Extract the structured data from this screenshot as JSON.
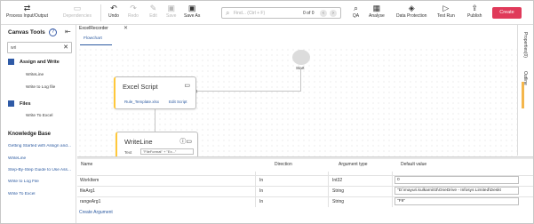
{
  "toolbar": {
    "process_io": "Process Input/Output",
    "dependencies": "Dependencies",
    "undo": "Undo",
    "redo": "Redo",
    "edit": "Edit",
    "save": "Save",
    "save_as": "Save As",
    "search_placeholder": "Find... (Ctrl + F)",
    "search_count": "0 of 0",
    "qa": "QA",
    "analyse": "Analyse",
    "data_protection": "Data Protection",
    "test_run": "Test Run",
    "publish": "Publish",
    "create": "Create"
  },
  "left_panel": {
    "title": "Canvas Tools",
    "filter_value": "wri",
    "tree": [
      {
        "group": "Assign and Write",
        "leaves": [
          "WriteLine",
          "Write to Log file"
        ]
      },
      {
        "group": "Files",
        "leaves": [
          "Write To Excel"
        ]
      }
    ],
    "kb_title": "Knowledge Base",
    "kb_links": [
      "Getting Started with Assign and...",
      "WriteLine",
      "Step-By-Step Guide to Use Ass...",
      "Write to Log File",
      "Write To Excel"
    ]
  },
  "tabs": {
    "main": "ExcelRecorder",
    "sub": "Flowchart"
  },
  "canvas": {
    "excel_node": {
      "title": "Excel Script",
      "link1": "Rule_Template.xlsx",
      "link2": "Edit Script"
    },
    "write_node": {
      "title": "WriteLine",
      "field": "Text",
      "field_value": "\"FileFormat\" + \"Ex...\""
    },
    "start_label": "Start"
  },
  "right_rail": {
    "properties": "Properties(0)",
    "outline": "Outline"
  },
  "arguments": {
    "headers": {
      "name": "Name",
      "direction": "Direction",
      "type": "Argument type",
      "default": "Default value"
    },
    "rows": [
      {
        "name": "WorkItem",
        "direction": "In",
        "type": "Int32",
        "default": "0"
      },
      {
        "name": "fileArg1",
        "direction": "In",
        "type": "String",
        "default": "\"D:\\mayuri.kulkarni03\\OneDrive - Infosys Limited\\Deskt"
      },
      {
        "name": "rangeArg1",
        "direction": "In",
        "type": "String",
        "default": "\"F9\""
      }
    ],
    "create_link": "Create Argument"
  },
  "colors": {
    "accent_red": "#e03a5a",
    "link_blue": "#2c5aa0",
    "node_yellow": "#ffc83a"
  }
}
